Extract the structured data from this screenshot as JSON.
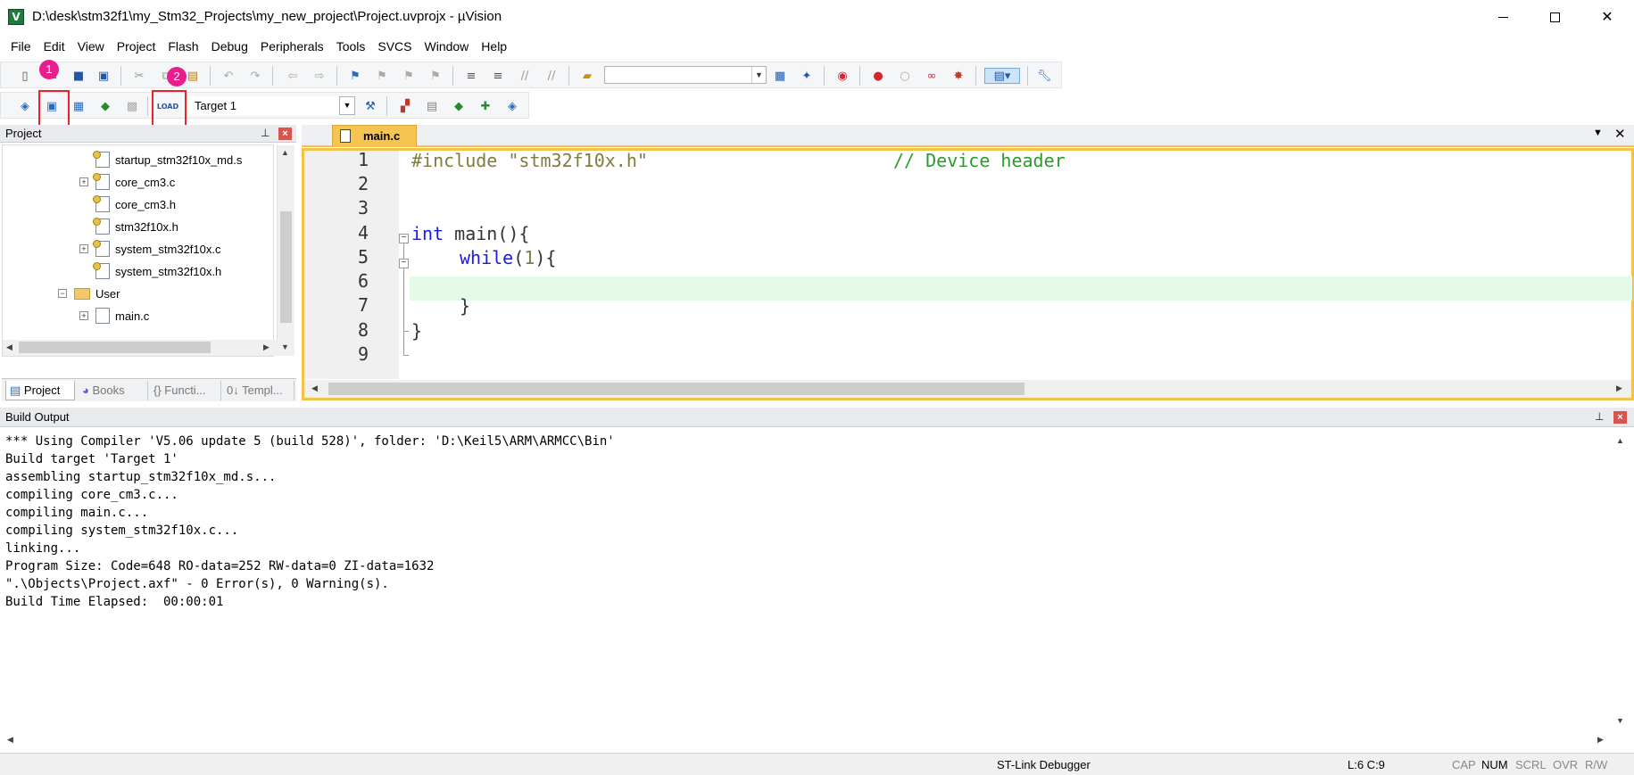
{
  "window": {
    "title": "D:\\desk\\stm32f1\\my_Stm32_Projects\\my_new_project\\Project.uvprojx - µVision",
    "app_icon": "V",
    "close_glyph": "✕"
  },
  "menu": [
    "File",
    "Edit",
    "View",
    "Project",
    "Flash",
    "Debug",
    "Peripherals",
    "Tools",
    "SVCS",
    "Window",
    "Help"
  ],
  "toolbar2": {
    "target": "Target 1"
  },
  "callouts": {
    "badge_1": "1",
    "badge_2": "2",
    "color": "#e91e8c",
    "box_color": "#e8232d"
  },
  "project_panel": {
    "title": "Project",
    "tree": [
      {
        "label": "startup_stm32f10x_md.s"
      },
      {
        "label": "core_cm3.c"
      },
      {
        "label": "core_cm3.h"
      },
      {
        "label": "stm32f10x.h"
      },
      {
        "label": "system_stm32f10x.c"
      },
      {
        "label": "system_stm32f10x.h"
      },
      {
        "label": "User"
      },
      {
        "label": "main.c"
      }
    ],
    "tabs": [
      "Project",
      "Books",
      "{} Functi...",
      "0↓ Templ..."
    ]
  },
  "editor": {
    "tab": "main.c",
    "line_numbers": [
      "1",
      "2",
      "3",
      "4",
      "5",
      "6",
      "7",
      "8",
      "9"
    ],
    "code": {
      "l1_pp": "#include ",
      "l1_str": "\"stm32f10x.h\"",
      "l1_cmt": "// Device header",
      "l4_kw": "int",
      "l4_rest": " main(){",
      "l5_kw": "while",
      "l5_open": "(",
      "l5_num": "1",
      "l5_close": "){",
      "l7": "}",
      "l8": "}"
    },
    "highlight_color": "#e3fbe6"
  },
  "build_output": {
    "title": "Build Output",
    "lines": [
      "*** Using Compiler 'V5.06 update 5 (build 528)', folder: 'D:\\Keil5\\ARM\\ARMCC\\Bin'",
      "Build target 'Target 1'",
      "assembling startup_stm32f10x_md.s...",
      "compiling core_cm3.c...",
      "compiling main.c...",
      "compiling system_stm32f10x.c...",
      "linking...",
      "Program Size: Code=648 RO-data=252 RW-data=0 ZI-data=1632",
      "\".\\Objects\\Project.axf\" - 0 Error(s), 0 Warning(s).",
      "Build Time Elapsed:  00:00:01"
    ]
  },
  "status": {
    "debugger": "ST-Link Debugger",
    "position": "L:6 C:9",
    "cap": "CAP",
    "num": "NUM",
    "scrl": "SCRL",
    "ovr": "OVR",
    "rw": "R/W"
  }
}
